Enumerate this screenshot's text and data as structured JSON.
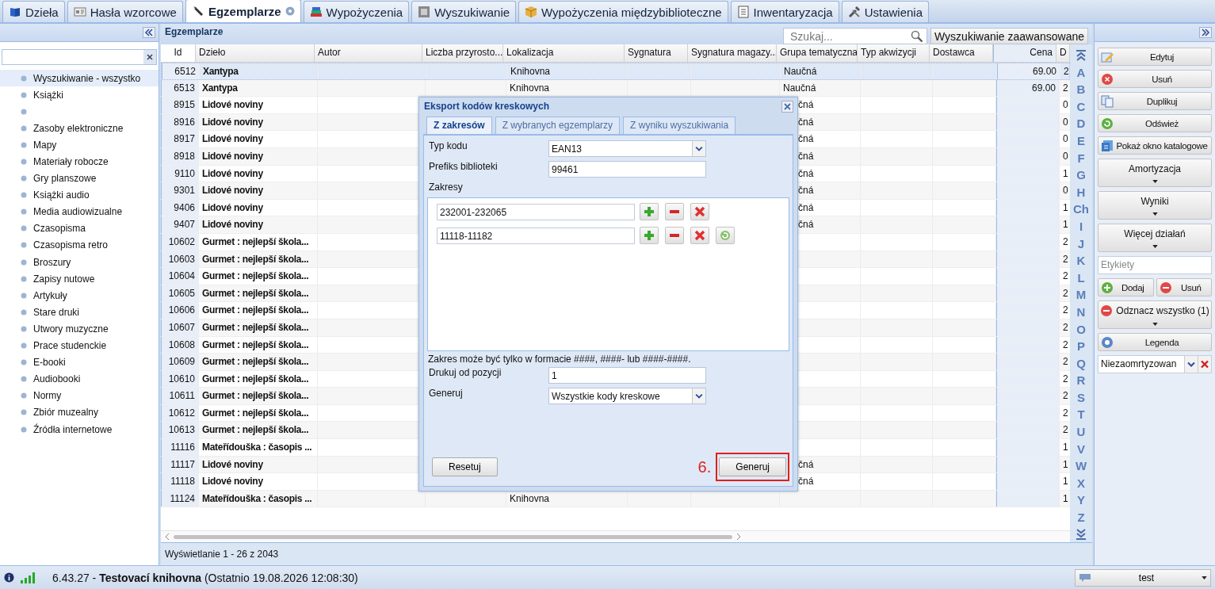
{
  "tabs": [
    {
      "label": "Dzieła",
      "selected": false,
      "has_help": false
    },
    {
      "label": "Hasła wzorcowe",
      "selected": false,
      "has_help": false
    },
    {
      "label": "Egzemplarze",
      "selected": true,
      "has_help": true
    },
    {
      "label": "Wypożyczenia",
      "selected": false,
      "has_help": false
    },
    {
      "label": "Wyszukiwanie",
      "selected": false,
      "has_help": false
    },
    {
      "label": "Wypożyczenia międzybiblioteczne",
      "selected": false,
      "has_help": false
    },
    {
      "label": "Inwentaryzacja",
      "selected": false,
      "has_help": false
    },
    {
      "label": "Ustawienia",
      "selected": false,
      "has_help": false
    }
  ],
  "sidebar": {
    "categories": [
      {
        "label": "Wyszukiwanie - wszystko",
        "selected": true
      },
      {
        "label": "Książki",
        "selected": false
      },
      {
        "selected": false
      },
      {
        "label": "Zasoby elektroniczne",
        "selected": false
      },
      {
        "label": "Mapy",
        "selected": false
      },
      {
        "label": "Materiały robocze",
        "selected": false
      },
      {
        "label": "Gry planszowe",
        "selected": false
      },
      {
        "label": "Książki audio",
        "selected": false
      },
      {
        "label": "Media audiowizualne",
        "selected": false
      },
      {
        "label": "Czasopisma",
        "selected": false
      },
      {
        "label": "Czasopisma retro",
        "selected": false
      },
      {
        "label": "Broszury",
        "selected": false
      },
      {
        "label": "Zapisy nutowe",
        "selected": false
      },
      {
        "label": "Artykuły",
        "selected": false
      },
      {
        "label": "Stare druki",
        "selected": false
      },
      {
        "label": "Utwory muzyczne",
        "selected": false
      },
      {
        "label": "Prace studenckie",
        "selected": false
      },
      {
        "label": "E-booki",
        "selected": false
      },
      {
        "label": "Audiobooki",
        "selected": false
      },
      {
        "label": "Normy",
        "selected": false
      },
      {
        "label": "Zbiór muzealny",
        "selected": false
      },
      {
        "label": "Źródła internetowe",
        "selected": false
      }
    ]
  },
  "panel": {
    "title": "Egzemplarze",
    "search_placeholder": "Szukaj...",
    "advanced_button": "Wyszukiwanie zaawansowane"
  },
  "table": {
    "columns": [
      "Id",
      "Dzieło",
      "Autor",
      "Liczba przyrosto...",
      "Lokalizacja",
      "Sygnatura",
      "Sygnatura magazy...",
      "Grupa tematyczna",
      "Typ akwizycji",
      "Dostawca",
      "Cena",
      "D"
    ],
    "rows": [
      {
        "selected": true,
        "id": "6512",
        "title": "Xantypa",
        "location": "Knihovna",
        "group": "Naučná",
        "price": "69.00",
        "column_12": "2"
      },
      {
        "selected": false,
        "id": "6513",
        "title": "Xantypa",
        "location": "Knihovna",
        "group": "Naučná",
        "price": "69.00",
        "column_12": "2"
      },
      {
        "selected": false,
        "id": "8915",
        "title": "Lidové noviny",
        "group": "čná",
        "column_12": "0"
      },
      {
        "selected": false,
        "id": "8916",
        "title": "Lidové noviny",
        "group": "čná",
        "column_12": "0"
      },
      {
        "selected": false,
        "id": "8917",
        "title": "Lidové noviny",
        "group": "čná",
        "column_12": "0"
      },
      {
        "selected": false,
        "id": "8918",
        "title": "Lidové noviny",
        "group": "čná",
        "column_12": "0"
      },
      {
        "selected": false,
        "id": "9110",
        "title": "Lidové noviny",
        "group": "čná",
        "column_12": "1"
      },
      {
        "selected": false,
        "id": "9301",
        "title": "Lidové noviny",
        "group": "čná",
        "column_12": "0"
      },
      {
        "selected": false,
        "id": "9406",
        "title": "Lidové noviny",
        "group": "čná",
        "column_12": "1"
      },
      {
        "selected": false,
        "id": "9407",
        "title": "Lidové noviny",
        "group": "čná",
        "column_12": "1"
      },
      {
        "selected": false,
        "id": "10602",
        "title": "Gurmet : nejlepší škola...",
        "column_12": "2"
      },
      {
        "selected": false,
        "id": "10603",
        "title": "Gurmet : nejlepší škola...",
        "column_12": "2"
      },
      {
        "selected": false,
        "id": "10604",
        "title": "Gurmet : nejlepší škola...",
        "column_12": "2"
      },
      {
        "selected": false,
        "id": "10605",
        "title": "Gurmet : nejlepší škola...",
        "column_12": "2"
      },
      {
        "selected": false,
        "id": "10606",
        "title": "Gurmet : nejlepší škola...",
        "column_12": "2"
      },
      {
        "selected": false,
        "id": "10607",
        "title": "Gurmet : nejlepší škola...",
        "column_12": "2"
      },
      {
        "selected": false,
        "id": "10608",
        "title": "Gurmet : nejlepší škola...",
        "column_12": "2"
      },
      {
        "selected": false,
        "id": "10609",
        "title": "Gurmet : nejlepší škola...",
        "column_12": "2"
      },
      {
        "selected": false,
        "id": "10610",
        "title": "Gurmet : nejlepší škola...",
        "column_12": "2"
      },
      {
        "selected": false,
        "id": "10611",
        "title": "Gurmet : nejlepší škola...",
        "column_12": "2"
      },
      {
        "selected": false,
        "id": "10612",
        "title": "Gurmet : nejlepší škola...",
        "column_12": "2"
      },
      {
        "selected": false,
        "id": "10613",
        "title": "Gurmet : nejlepší škola...",
        "column_12": "2"
      },
      {
        "selected": false,
        "id": "11116",
        "title": "Mateřídouška : časopis ...",
        "column_12": "1"
      },
      {
        "selected": false,
        "id": "11117",
        "title": "Lidové noviny",
        "group": "čná",
        "column_12": "1"
      },
      {
        "selected": false,
        "id": "11118",
        "title": "Lidové noviny",
        "group": "čná",
        "column_12": "1"
      },
      {
        "selected": false,
        "id": "11124",
        "title": "Mateřídouška : časopis ...",
        "location": "Knihovna",
        "column_12": "1"
      }
    ]
  },
  "alphabet": [
    "A",
    "B",
    "C",
    "D",
    "E",
    "F",
    "G",
    "H",
    "Ch",
    "I",
    "J",
    "K",
    "L",
    "M",
    "N",
    "O",
    "P",
    "Q",
    "R",
    "S",
    "T",
    "U",
    "V",
    "W",
    "X",
    "Y",
    "Z"
  ],
  "footer": "Wyświetlanie 1 - 26 z 2043",
  "actions": [
    {
      "label": "Edytuj",
      "kind": "icon"
    },
    {
      "label": "Usuń",
      "kind": "icon"
    },
    {
      "label": "Duplikuj",
      "kind": "icon"
    },
    {
      "label": "Odśwież",
      "kind": "icon"
    },
    {
      "label": "Pokaż okno katalogowe",
      "kind": "icon"
    },
    {
      "label": "Amortyzacja",
      "kind": "menu"
    },
    {
      "label": "Wyniki",
      "kind": "menu"
    },
    {
      "label": "Więcej działań",
      "kind": "menu"
    }
  ],
  "labels": {
    "placeholder": "Etykiety",
    "add": "Dodaj",
    "remove": "Usuń",
    "unselect": "Odznacz wszystko (1)",
    "legend": "Legenda",
    "filter": "Niezaomrtyzowan"
  },
  "dialog": {
    "title": "Eksport kodów kreskowych",
    "tabs": [
      {
        "label": "Z zakresów",
        "selected": true
      },
      {
        "label": "Z wybranych egzemplarzy",
        "selected": false
      },
      {
        "label": "Z wyniku wyszukiwania",
        "selected": false
      }
    ],
    "code_type": {
      "label": "Typ kodu",
      "value": "EAN13"
    },
    "prefix": {
      "label": "Prefiks biblioteki",
      "value": "99461"
    },
    "ranges_label": "Zakresy",
    "ranges": [
      {
        "value": "232001-232065",
        "restore_shown": false
      },
      {
        "value": "11118-11182",
        "restore_shown": true
      }
    ],
    "hint": "Zakres może być tylko w formacie ####, ####- lub ####-####.",
    "start": {
      "label": "Drukuj od pozycji",
      "value": "1"
    },
    "generate_mode": {
      "label": "Generuj",
      "value": "Wszystkie kody kreskowe"
    },
    "reset_button": "Resetuj",
    "generate_button": "Generuj",
    "step_marker": "6."
  },
  "status_bar": {
    "text": "6.43.27 - **Testovací knihovna** (Ostatnio 19.08.2026 12:08:30)",
    "user": "test"
  }
}
